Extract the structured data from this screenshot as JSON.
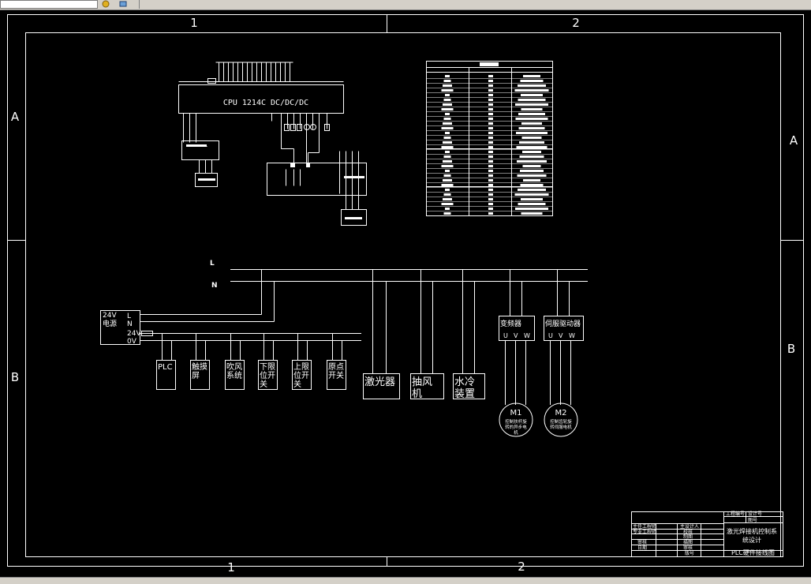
{
  "frame": {
    "cols": [
      "1",
      "2"
    ],
    "rows": [
      "A",
      "B"
    ]
  },
  "plc": {
    "cpu_label": "CPU 1214C DC/DC/DC"
  },
  "power": {
    "L": "L",
    "N": "N"
  },
  "psu": {
    "title_line1": "24V",
    "title_line2": "电源",
    "t_L": "L",
    "t_N": "N",
    "t_24V": "24V",
    "t_0V": "0V"
  },
  "dc_loads": [
    {
      "line1": "PLC",
      "line2": ""
    },
    {
      "line1": "触摸",
      "line2": "屏"
    },
    {
      "line1": "吹风",
      "line2": "系统"
    },
    {
      "line1": "下限",
      "line2": "位开",
      "line3": "关"
    },
    {
      "line1": "上限",
      "line2": "位开",
      "line3": "关"
    },
    {
      "line1": "原点",
      "line2": "开关"
    }
  ],
  "ac_loads": [
    {
      "line1": "激光器",
      "line2": ""
    },
    {
      "line1": "抽风",
      "line2": "机"
    },
    {
      "line1": "水冷",
      "line2": "装置"
    }
  ],
  "drives": [
    {
      "name": "变频器",
      "u": "U",
      "v": "V",
      "w": "W",
      "motor": "M1",
      "motor_desc1": "控制扶杆旋",
      "motor_desc2": "转的异步电",
      "motor_desc3": "机"
    },
    {
      "name": "伺服驱动器",
      "u": "U",
      "v": "V",
      "w": "W",
      "motor": "M2",
      "motor_desc1": "控制齿轮旋",
      "motor_desc2": "转伺服电机",
      "motor_desc3": ""
    }
  ],
  "title_block": {
    "project_no_label": "工程编号",
    "drawing_no_label": "图号",
    "chief_engineer": "主任工程师",
    "deputy_chief": "专业工程师",
    "designer": "主设计人",
    "checker": "校核",
    "drafter": "制图",
    "reviewer": "描图",
    "approver": "审核",
    "date_label": "日期",
    "title_line1": "激光焊接机控制系",
    "title_line2": "统设计",
    "sheet_title": "PLC硬件接线图",
    "batch_label": "设计号",
    "rev_label": "版号"
  }
}
